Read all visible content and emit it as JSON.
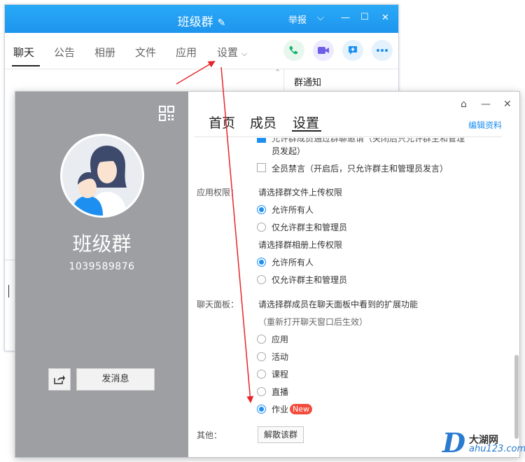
{
  "back_window": {
    "title": "班级群",
    "report": "举报",
    "tabs": [
      "聊天",
      "公告",
      "相册",
      "文件",
      "应用",
      "设置"
    ],
    "side_title": "群通知"
  },
  "profile": {
    "group_name": "班级群",
    "group_id": "1039589876",
    "send_message": "发消息",
    "nav": [
      "首页",
      "成员",
      "设置"
    ],
    "edit_profile": "编辑资料"
  },
  "settings": {
    "partial_top": "允许群成员通过群聊邀请（关闭后只允许群主和管理",
    "partial_top_cont": "员发起）",
    "mute_all": "全员禁言（开启后，只允许群主和管理员发言）",
    "app_perm_label": "应用权限：",
    "file_upload_title": "请选择群文件上传权限",
    "file_opt_all": "允许所有人",
    "file_opt_admin": "仅允许群主和管理员",
    "album_upload_title": "请选择群相册上传权限",
    "album_opt_all": "允许所有人",
    "album_opt_admin": "仅允许群主和管理员",
    "chat_panel_label": "聊天面板：",
    "chat_panel_desc": "请选择群成员在聊天面板中看到的扩展功能",
    "chat_panel_note": "（重新打开聊天窗口后生效）",
    "panel_items": [
      "应用",
      "活动",
      "课程",
      "直播",
      "作业"
    ],
    "new_badge": "New",
    "other_label": "其他：",
    "dissolve": "解散该群"
  },
  "watermark": {
    "letter": "D",
    "cn": "大湖网",
    "url": "ahu123.com"
  },
  "colors": {
    "accent": "#1d8ff0",
    "title_bar": "#2aa9f7",
    "arrow": "#e8242a",
    "left_panel": "#9d9fa3"
  }
}
